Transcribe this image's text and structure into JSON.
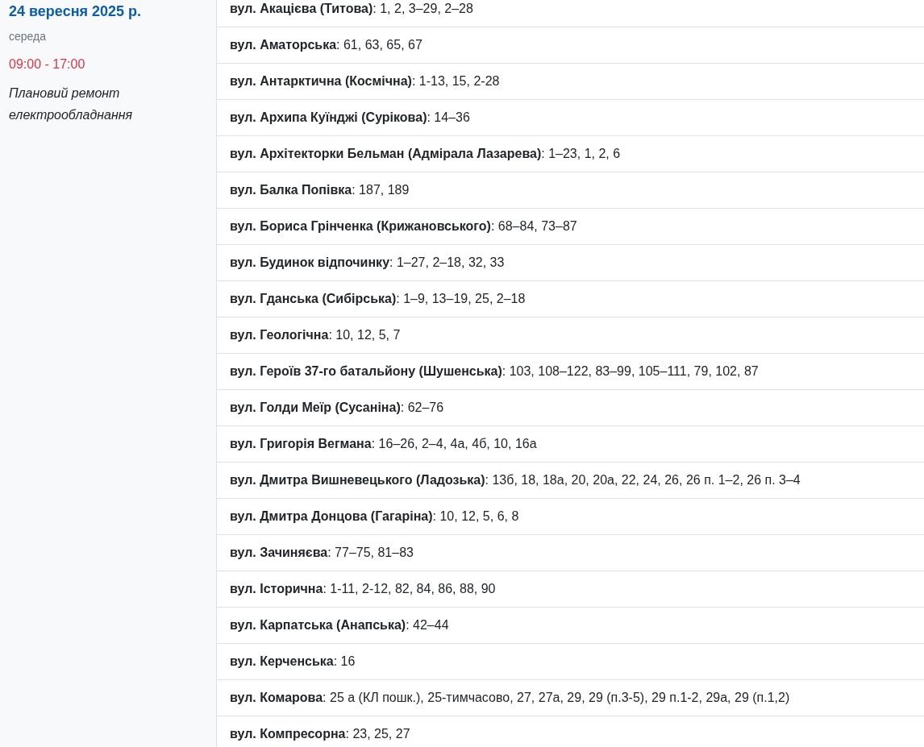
{
  "sidebar": {
    "date": "24 вересня 2025 р.",
    "weekday": "середа",
    "time": "09:00 - 17:00",
    "reason": "Плановий ремонт електрообладнання"
  },
  "addresses": [
    "**вул. Акацієва (Титова)**: 1, 2, 3–29, 2–28",
    "**вул. Аматорська**: 61, 63, 65, 67",
    "**вул. Антарктична (Космічна)**: 1-13, 15, 2-28",
    "**вул. Архипа Куїнджі (Сурікова)**: 14–36",
    "**вул. Архітекторки Бельман (Адмірала Лазарева)**: 1–23, 1, 2, 6",
    "**вул. Балка Попівка**: 187, 189",
    "**вул. Бориса Грінченка (Крижановського)**: 68–84, 73–87",
    "**вул. Будинок відпочинку**: 1–27, 2–18, 32, 33",
    "**вул. Гданська (Сибірська)**: 1–9, 13–19, 25, 2–18",
    "**вул. Геологічна**: 10, 12, 5, 7",
    "**вул. Героїв 37-го батальйону (Шушенська)**: 103, 108–122, 83–99, 105–111, 79, 102, 87",
    "**вул. Голди Меїр (Сусаніна)**: 62–76",
    "**вул. Григорія Вегмана**: 16–26, 2–4, 4а, 4б, 10, 16а",
    "**вул. Дмитра Вишневецького (Ладозька)**: 13б, 18, 18а, 20, 20а, 22, 24, 26, 26 п. 1–2, 26 п. 3–4",
    "**вул. Дмитра Донцова (Гагаріна)**: 10, 12, 5, 6, 8",
    "**вул. Зачиняєва**: 77–75, 81–83",
    "**вул. Історична**: 1-11, 2-12, 82, 84, 86, 88, 90",
    "**вул. Карпатська (Анапська)**: 42–44",
    "**вул. Керченська**: 16",
    "**вул. Комарова**: 25 а (КЛ пошк.), 25-тимчасово, 27, 27а, 29, 29 (п.3-5), 29 п.1-2, 29а, 29 (п.1,2)",
    "**вул. Компресорна**: 23, 25, 27"
  ]
}
